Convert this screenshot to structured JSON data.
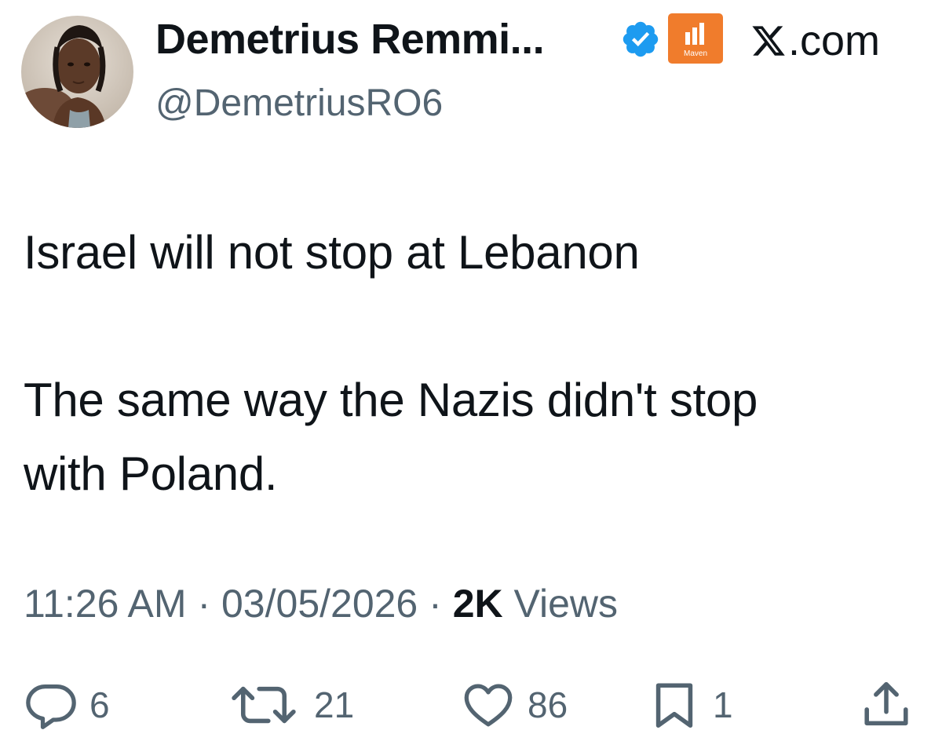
{
  "author": {
    "display_name": "Demetrius Remmi...",
    "handle": "@DemetriusRO6",
    "verified_icon": "verified-badge-icon",
    "affiliate_badge": {
      "icon": "maven-logo-icon",
      "label": "Maven",
      "color": "#f07c2c"
    }
  },
  "source": {
    "icon": "x-logo-icon",
    "label": ".com"
  },
  "tweet": {
    "lines": [
      "Israel will not stop at Lebanon",
      "The same way the Nazis didn't stop",
      "with Poland."
    ]
  },
  "meta": {
    "time": "11:26 AM",
    "separator": "·",
    "date": "03/05/2026",
    "views_count": "2K",
    "views_label": "Views"
  },
  "actions": {
    "replies": {
      "icon": "reply-icon",
      "count": "6"
    },
    "reposts": {
      "icon": "repost-icon",
      "count": "21"
    },
    "likes": {
      "icon": "heart-icon",
      "count": "86"
    },
    "bookmarks": {
      "icon": "bookmark-icon",
      "count": "1"
    },
    "share": {
      "icon": "share-icon"
    }
  },
  "colors": {
    "text_primary": "#0f1419",
    "text_secondary": "#536471",
    "verified_blue": "#1d9bf0",
    "background": "#ffffff"
  }
}
